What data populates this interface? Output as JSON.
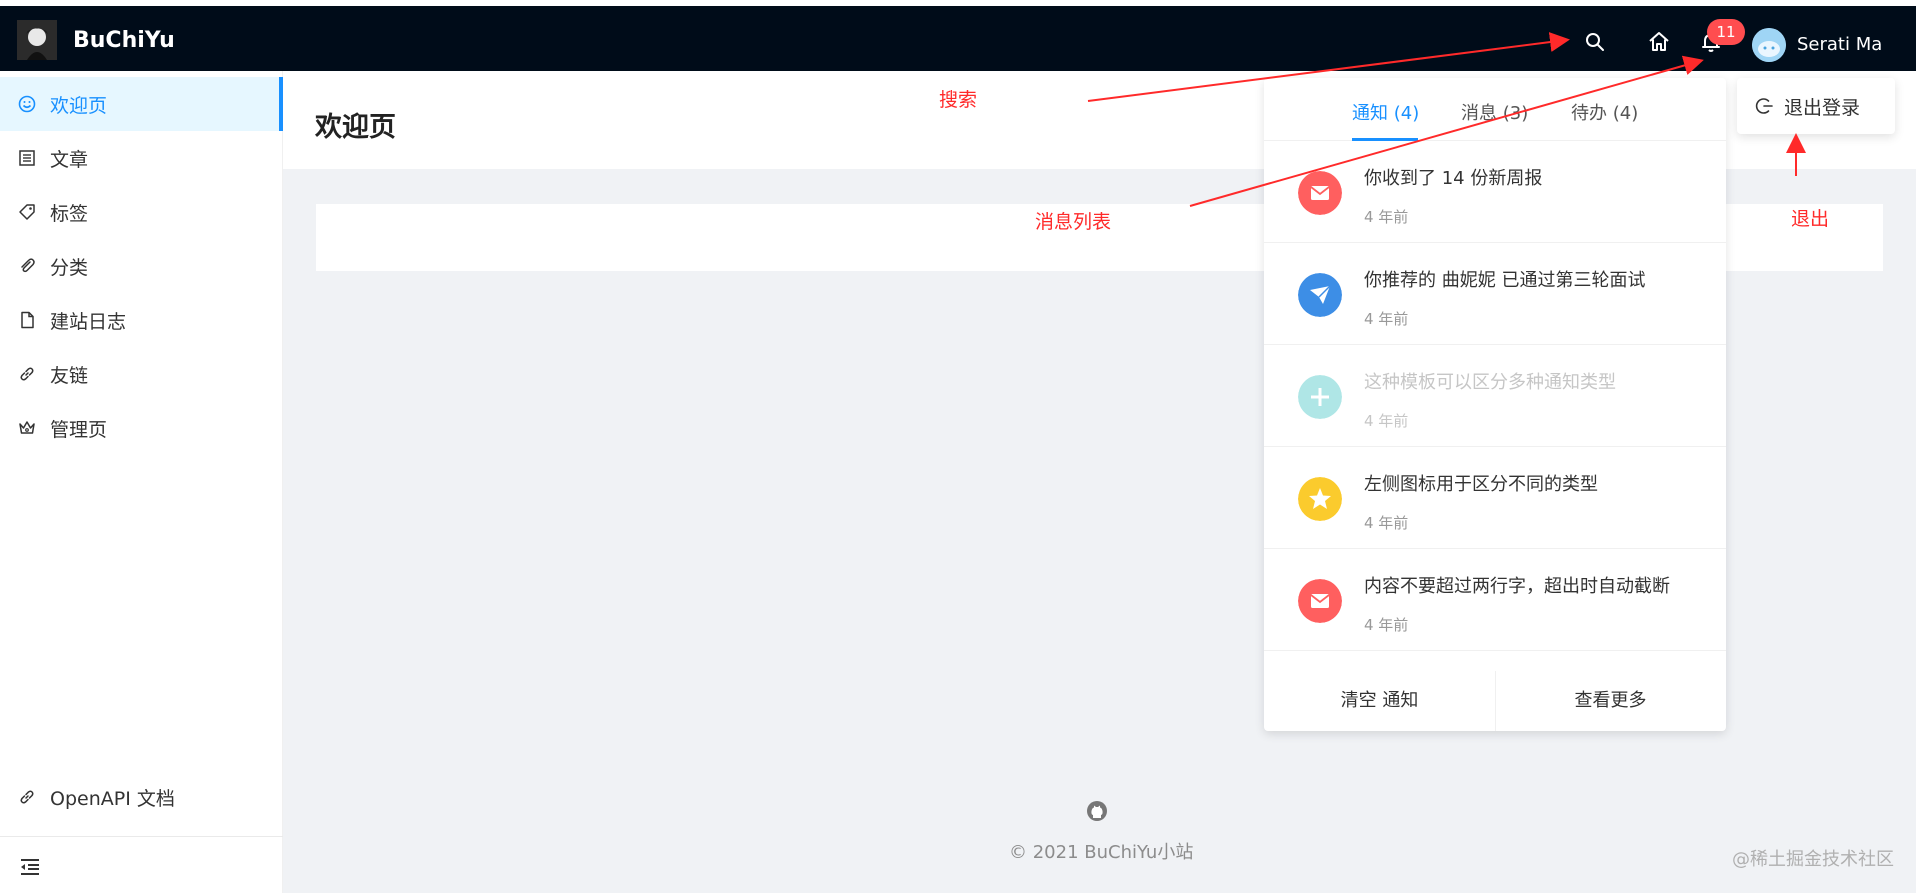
{
  "header": {
    "logo_title": "BuChiYu",
    "notification_count": "11",
    "username": "Serati Ma",
    "icons": [
      "search-icon",
      "home-icon",
      "bell-icon"
    ]
  },
  "sidebar": {
    "items": [
      {
        "label": "欢迎页",
        "icon": "smile-icon",
        "active": true
      },
      {
        "label": "文章",
        "icon": "list-icon"
      },
      {
        "label": "标签",
        "icon": "tag-icon"
      },
      {
        "label": "分类",
        "icon": "paperclip-icon"
      },
      {
        "label": "建站日志",
        "icon": "file-icon"
      },
      {
        "label": "友链",
        "icon": "link-icon"
      },
      {
        "label": "管理页",
        "icon": "crown-icon"
      }
    ],
    "bottom_item": {
      "label": "OpenAPI 文档",
      "icon": "link-icon"
    },
    "collapse_icon": "menu-fold-icon"
  },
  "main": {
    "page_title": "欢迎页",
    "footer_copyright": "© 2021 BuChiYu小站",
    "footer_icon": "github-icon",
    "watermark": "@稀土掘金技术社区"
  },
  "notice": {
    "tabs": [
      {
        "label": "通知 (4)",
        "active": true
      },
      {
        "label": "消息 (3)"
      },
      {
        "label": "待办 (4)"
      }
    ],
    "items": [
      {
        "title": "你收到了 14 份新周报",
        "time": "4 年前",
        "icon": "mail-icon",
        "color": "#ff5f5f",
        "read": false
      },
      {
        "title": "你推荐的 曲妮妮 已通过第三轮面试",
        "time": "4 年前",
        "icon": "send-icon",
        "color": "#3d8ee6",
        "read": false
      },
      {
        "title": "这种模板可以区分多种通知类型",
        "time": "4 年前",
        "icon": "plus-icon",
        "color": "#4fc9c9",
        "read": true
      },
      {
        "title": "左侧图标用于区分不同的类型",
        "time": "4 年前",
        "icon": "star-icon",
        "color": "#fbcb2d",
        "read": false
      },
      {
        "title": "内容不要超过两行字，超出时自动截断",
        "time": "4 年前",
        "icon": "mail-icon",
        "color": "#ff5f5f",
        "read": false
      }
    ],
    "footer": {
      "clear_label": "清空 通知",
      "more_label": "查看更多"
    }
  },
  "logout": {
    "label": "退出登录",
    "icon": "logout-icon"
  },
  "annotations": {
    "search": "搜索",
    "message_list": "消息列表",
    "logout": "退出",
    "color": "#ff2a2a"
  }
}
